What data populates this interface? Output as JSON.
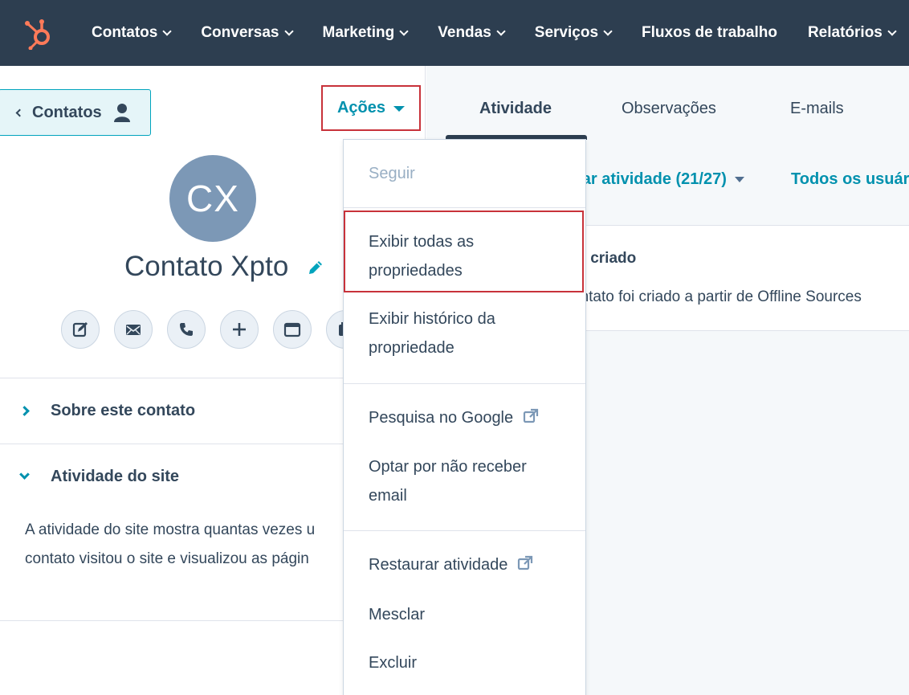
{
  "nav": {
    "items": [
      {
        "label": "Contatos",
        "dropdown": true
      },
      {
        "label": "Conversas",
        "dropdown": true
      },
      {
        "label": "Marketing",
        "dropdown": true
      },
      {
        "label": "Vendas",
        "dropdown": true
      },
      {
        "label": "Serviços",
        "dropdown": true
      },
      {
        "label": "Fluxos de trabalho",
        "dropdown": false
      },
      {
        "label": "Relatórios",
        "dropdown": true
      }
    ]
  },
  "left": {
    "back_label": "Contatos",
    "actions_label": "Ações",
    "avatar_initials": "CX",
    "contact_name": "Contato Xpto",
    "action_icons": [
      "note-icon",
      "email-icon",
      "phone-icon",
      "plus-icon",
      "meeting-icon",
      "calendar-icon"
    ],
    "sections": {
      "about": "Sobre este contato",
      "site_activity": "Atividade do site"
    },
    "site_desc_line1": "A atividade do site mostra quantas vezes u",
    "site_desc_line2": "contato visitou o site e visualizou as págin"
  },
  "right": {
    "tabs": [
      "Atividade",
      "Observações",
      "E-mails"
    ],
    "filter_activity": "rar atividade (21/27)",
    "filter_users": "Todos os usuári",
    "card_title": "to criado",
    "card_body": "ontato foi criado a partir de Offline Sources"
  },
  "dropdown": {
    "follow": "Seguir",
    "view_all_1": "Exibir todas as",
    "view_all_2": "propriedades",
    "history_1": "Exibir histórico da",
    "history_2": "propriedade",
    "google": "Pesquisa no Google",
    "optout_1": "Optar por não receber",
    "optout_2": "email",
    "restore": "Restaurar atividade",
    "merge": "Mesclar",
    "delete": "Excluir"
  },
  "colors": {
    "nav_bg": "#2d3e50",
    "accent": "#0091ae",
    "highlight": "#c8323a",
    "brand_orange": "#ff7a59"
  }
}
